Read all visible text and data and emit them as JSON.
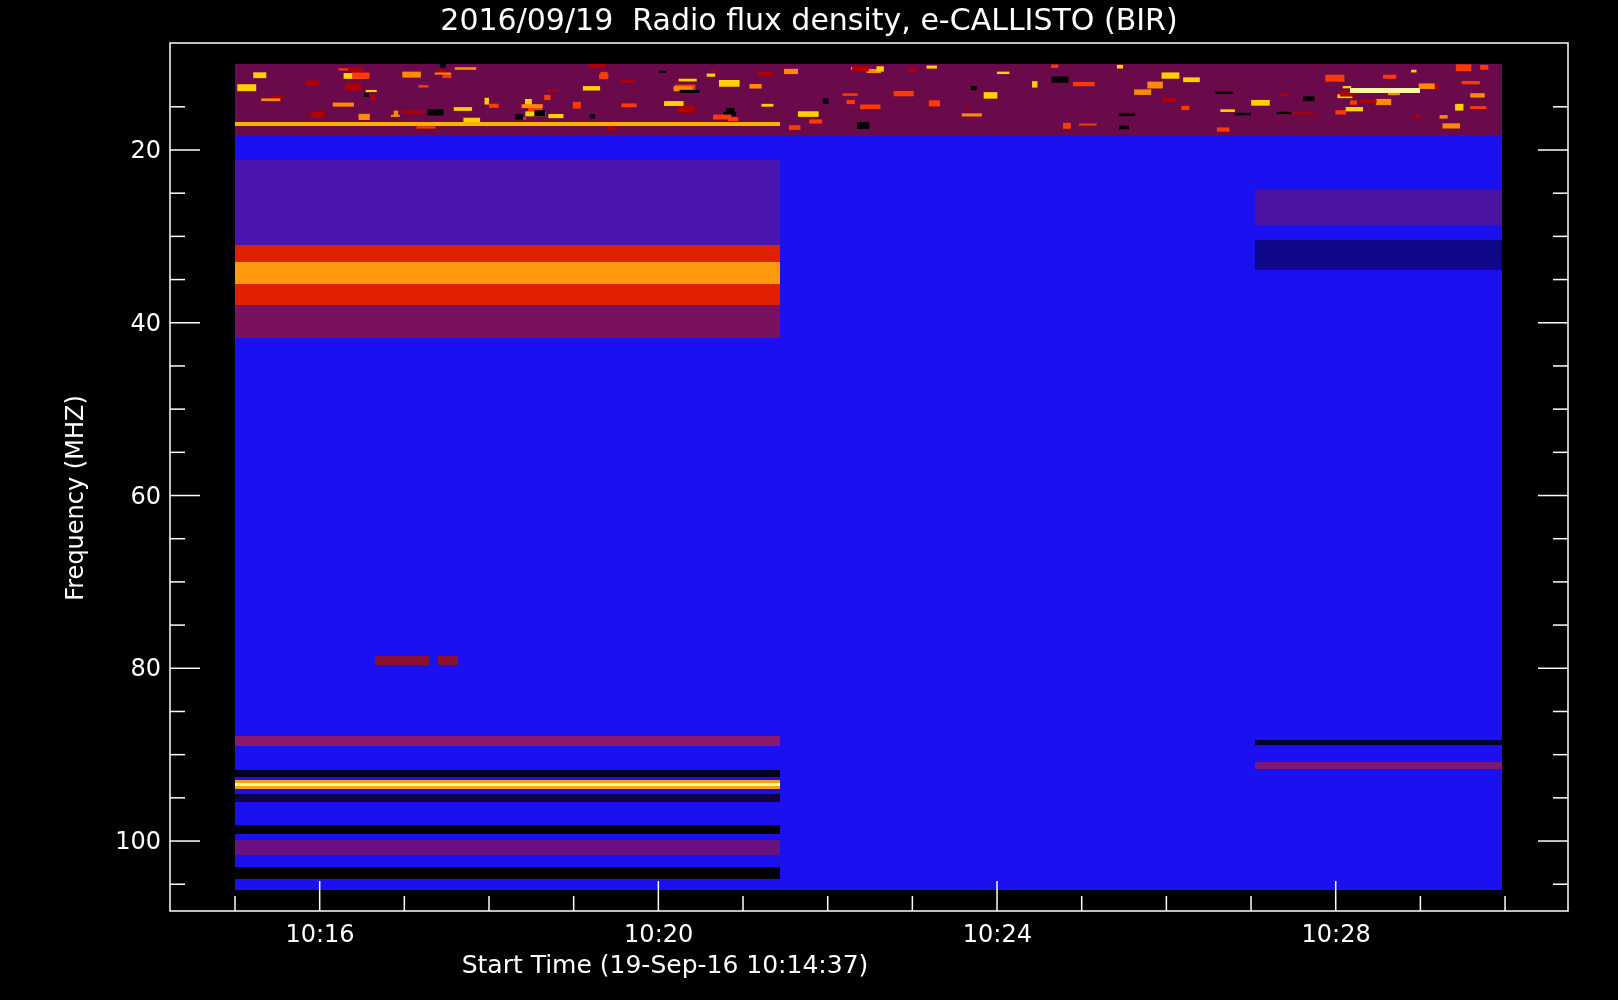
{
  "title": "2016/09/19  Radio flux density, e-CALLISTO (BIR)",
  "y_axis": {
    "label": "Frequency (MHZ)",
    "ticks": [
      "20",
      "40",
      "60",
      "80",
      "100"
    ]
  },
  "x_axis": {
    "label": "Start Time (19-Sep-16 10:14:37)",
    "ticks": [
      "10:16",
      "10:20",
      "10:24",
      "10:28"
    ]
  }
}
